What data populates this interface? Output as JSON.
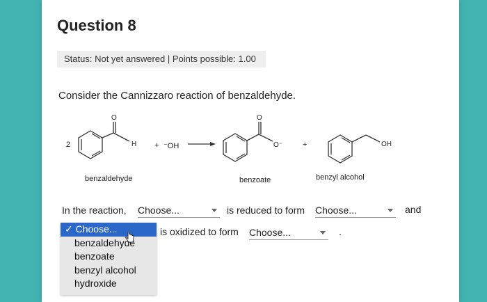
{
  "question": {
    "title": "Question 8",
    "status": "Status: Not yet answered | Points possible: 1.00",
    "prompt": "Consider the Cannizzaro reaction of benzaldehyde."
  },
  "scheme": {
    "coef": "2",
    "h_label": "H",
    "o_label": "O",
    "plus1": "+",
    "hydroxide": "⁻OH",
    "carboxylate_o": "O⁻",
    "plus2": "+",
    "oh_label": "OH",
    "names": [
      "benzaldehyde",
      "benzoate",
      "benzyl alcohol"
    ]
  },
  "sentence": {
    "part1": "In the reaction,",
    "part2": "is reduced to form",
    "part3": "and",
    "part4": "is oxidized to form",
    "part5": "."
  },
  "selects": {
    "reduced_reactant": "Choose...",
    "reduced_product": "Choose...",
    "oxidized_product": "Choose..."
  },
  "dropdown": {
    "selected_mark": "✓",
    "options": [
      "Choose...",
      "benzaldehyde",
      "benzoate",
      "benzyl alcohol",
      "hydroxide"
    ]
  }
}
